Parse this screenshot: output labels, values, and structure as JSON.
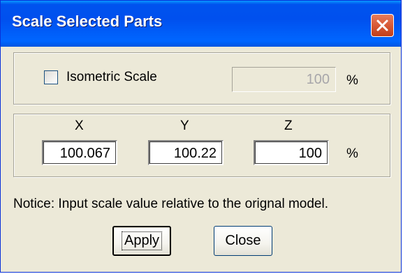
{
  "window": {
    "title": "Scale Selected Parts"
  },
  "icons": {
    "close": "close-icon"
  },
  "isometric": {
    "label": "Isometric Scale",
    "checked": false,
    "value": "100",
    "unit": "%"
  },
  "axes": {
    "x_label": "X",
    "y_label": "Y",
    "z_label": "Z",
    "x_value": "100.067",
    "y_value": "100.22",
    "z_value": "100",
    "unit": "%"
  },
  "notice": "Notice: Input scale value relative to the orignal model.",
  "buttons": {
    "apply": "Apply",
    "close": "Close"
  },
  "colors": {
    "titlebar": "#0054e3",
    "close_button": "#d85a36",
    "dialog_bg": "#ece9d8"
  }
}
